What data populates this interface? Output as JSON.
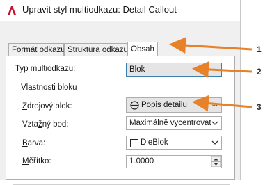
{
  "window": {
    "title": "Upravit styl multiodkazu: Detail Callout"
  },
  "tabs": [
    {
      "label": "Formát odkazu"
    },
    {
      "label": "Struktura odkazu"
    },
    {
      "label": "Obsah"
    }
  ],
  "fields": {
    "type": {
      "label_before": "T",
      "label_mnemonic": "y",
      "label_after": "p multiodkazu:",
      "value": "Blok"
    },
    "group_title": "Vlastnosti bloku",
    "source_block": {
      "label_mnemonic": "Z",
      "label_after": "drojový blok:",
      "value": "Popis detailu"
    },
    "attach_point": {
      "label_before": "Vzta",
      "label_mnemonic": "ž",
      "label_after": "ný bod:",
      "value": "Maximálně vycentrovat"
    },
    "color": {
      "label_mnemonic": "B",
      "label_after": "arva:",
      "value": "DleBlok"
    },
    "scale": {
      "label_mnemonic": "M",
      "label_after": "ěřítko:",
      "value": "1.0000"
    }
  },
  "ellipsis": "...",
  "callouts": [
    "1",
    "2",
    "3"
  ],
  "colors": {
    "arrow": "#e8822a",
    "app_icon": "#c8102e"
  }
}
